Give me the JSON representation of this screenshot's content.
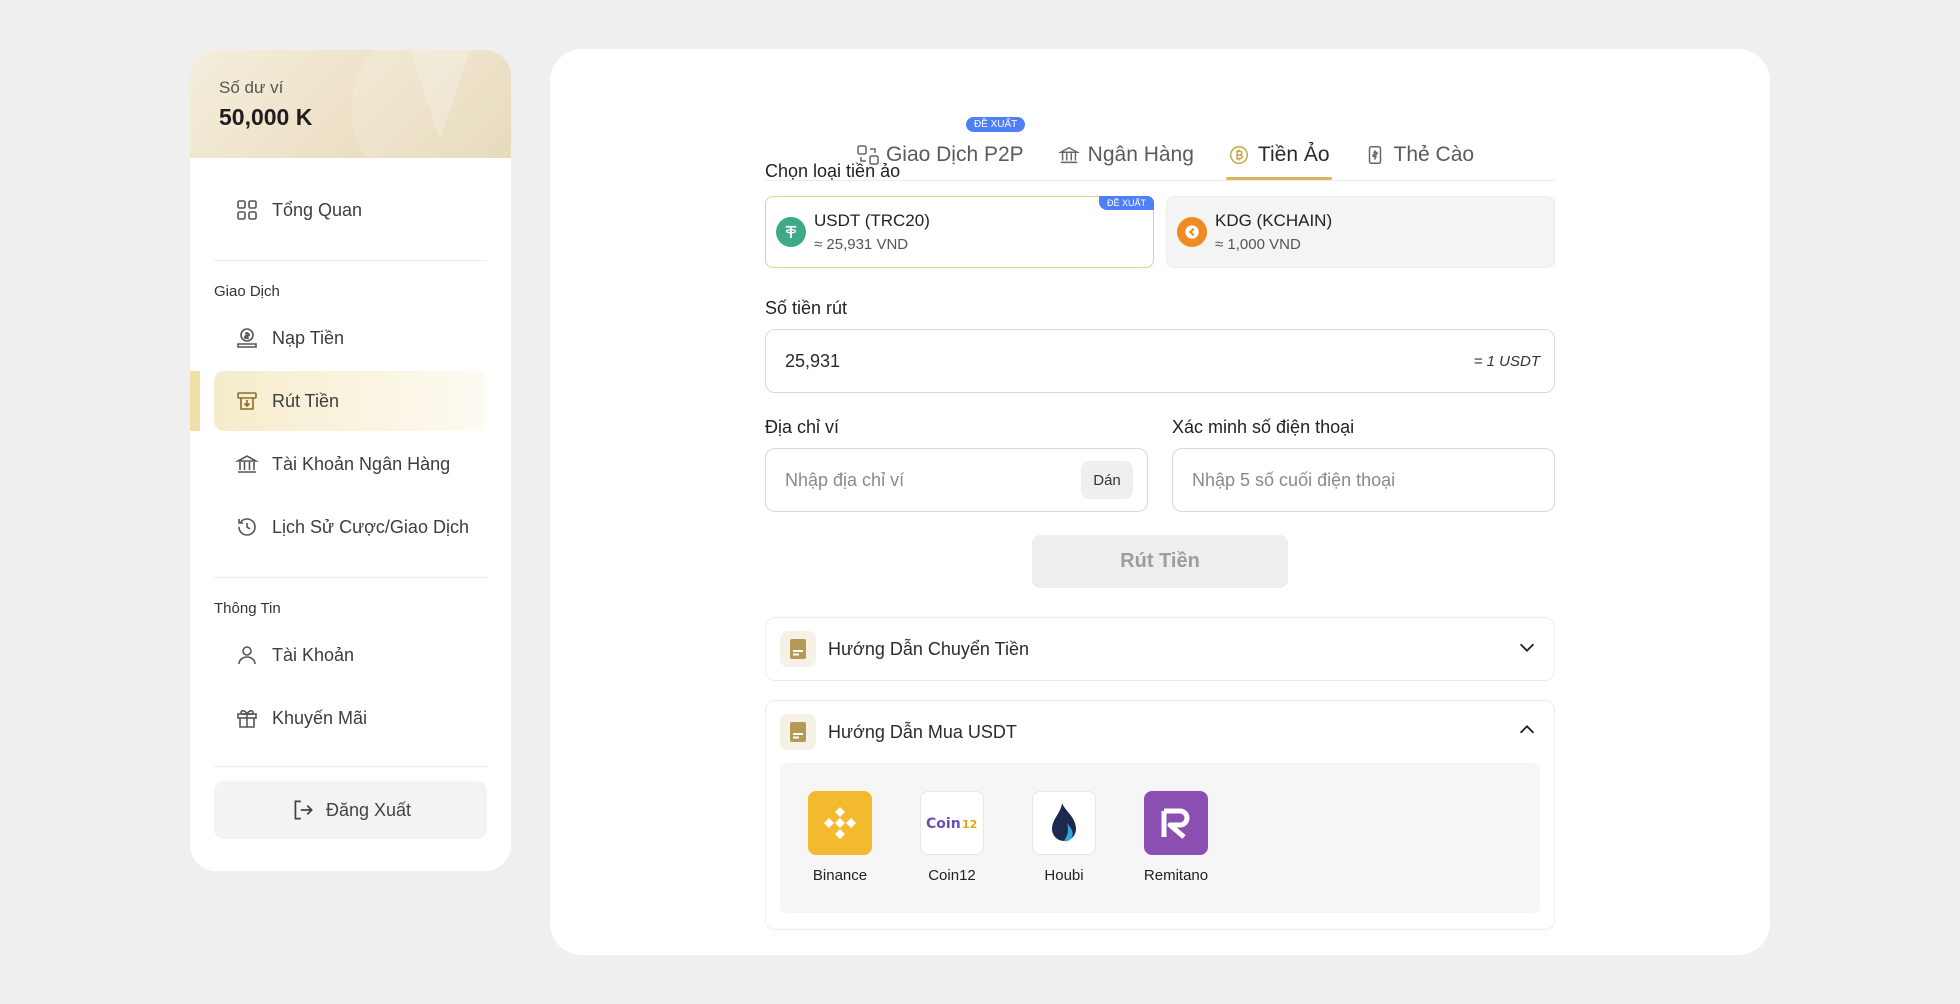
{
  "sidebar": {
    "balance_label": "Số dư ví",
    "balance_value": "50,000 K",
    "overview": "Tổng Quan",
    "section_transactions": "Giao Dịch",
    "deposit": "Nạp Tiền",
    "withdraw": "Rút Tiền",
    "bank_account": "Tài Khoản Ngân Hàng",
    "history": "Lịch Sử Cược/Giao Dịch",
    "section_info": "Thông Tin",
    "account": "Tài Khoản",
    "promotion": "Khuyến Mãi",
    "logout": "Đăng Xuất"
  },
  "tabs": {
    "p2p": "Giao Dịch P2P",
    "p2p_badge": "ĐỀ XUẤT",
    "bank": "Ngân Hàng",
    "crypto": "Tiền Ảo",
    "card": "Thẻ Cào",
    "active": "crypto"
  },
  "form": {
    "coin_label": "Chọn loại tiền ảo",
    "coins": [
      {
        "name": "USDT (TRC20)",
        "rate": "≈ 25,931 VND",
        "badge": "ĐỀ XUẤT",
        "selected": true
      },
      {
        "name": "KDG (KCHAIN)",
        "rate": "≈ 1,000 VND",
        "selected": false
      }
    ],
    "amount_label": "Số tiền rút",
    "amount_value": "25,931",
    "amount_suffix": "= 1 USDT",
    "wallet_label": "Địa chỉ ví",
    "wallet_placeholder": "Nhập địa chỉ ví",
    "paste_button": "Dán",
    "phone_label": "Xác minh số điện thoại",
    "phone_placeholder": "Nhập 5 số cuối điện thoại",
    "submit": "Rút Tiền"
  },
  "guides": {
    "transfer_title": "Hướng Dẫn Chuyển Tiền",
    "buy_title": "Hướng Dẫn Mua USDT",
    "exchanges": [
      "Binance",
      "Coin12",
      "Houbi",
      "Remitano"
    ]
  },
  "colors": {
    "accent": "#d9b659",
    "badge": "#4f7ef5",
    "usdt": "#3fa988",
    "kdg": "#f08a24",
    "binance": "#f3ba2f",
    "remitano": "#8a4fb0"
  }
}
